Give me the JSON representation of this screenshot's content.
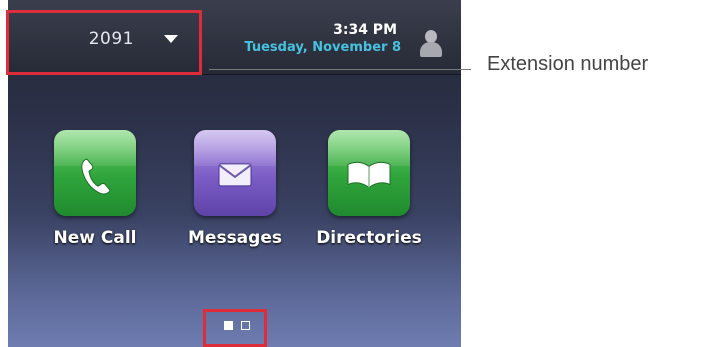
{
  "header": {
    "extension": "2091",
    "time": "3:34 PM",
    "date": "Tuesday, November 8"
  },
  "apps": [
    {
      "label": "New Call",
      "icon": "phone-icon",
      "color": "#2fa43b"
    },
    {
      "label": "Messages",
      "icon": "envelope-icon",
      "color": "#7b5cc6"
    },
    {
      "label": "Directories",
      "icon": "book-icon",
      "color": "#2fa43b"
    }
  ],
  "pager": {
    "pages": 2,
    "current": 1
  },
  "callout": {
    "label": "Extension number"
  },
  "colors": {
    "highlight": "#dd2d3b",
    "date": "#47c1e0"
  }
}
